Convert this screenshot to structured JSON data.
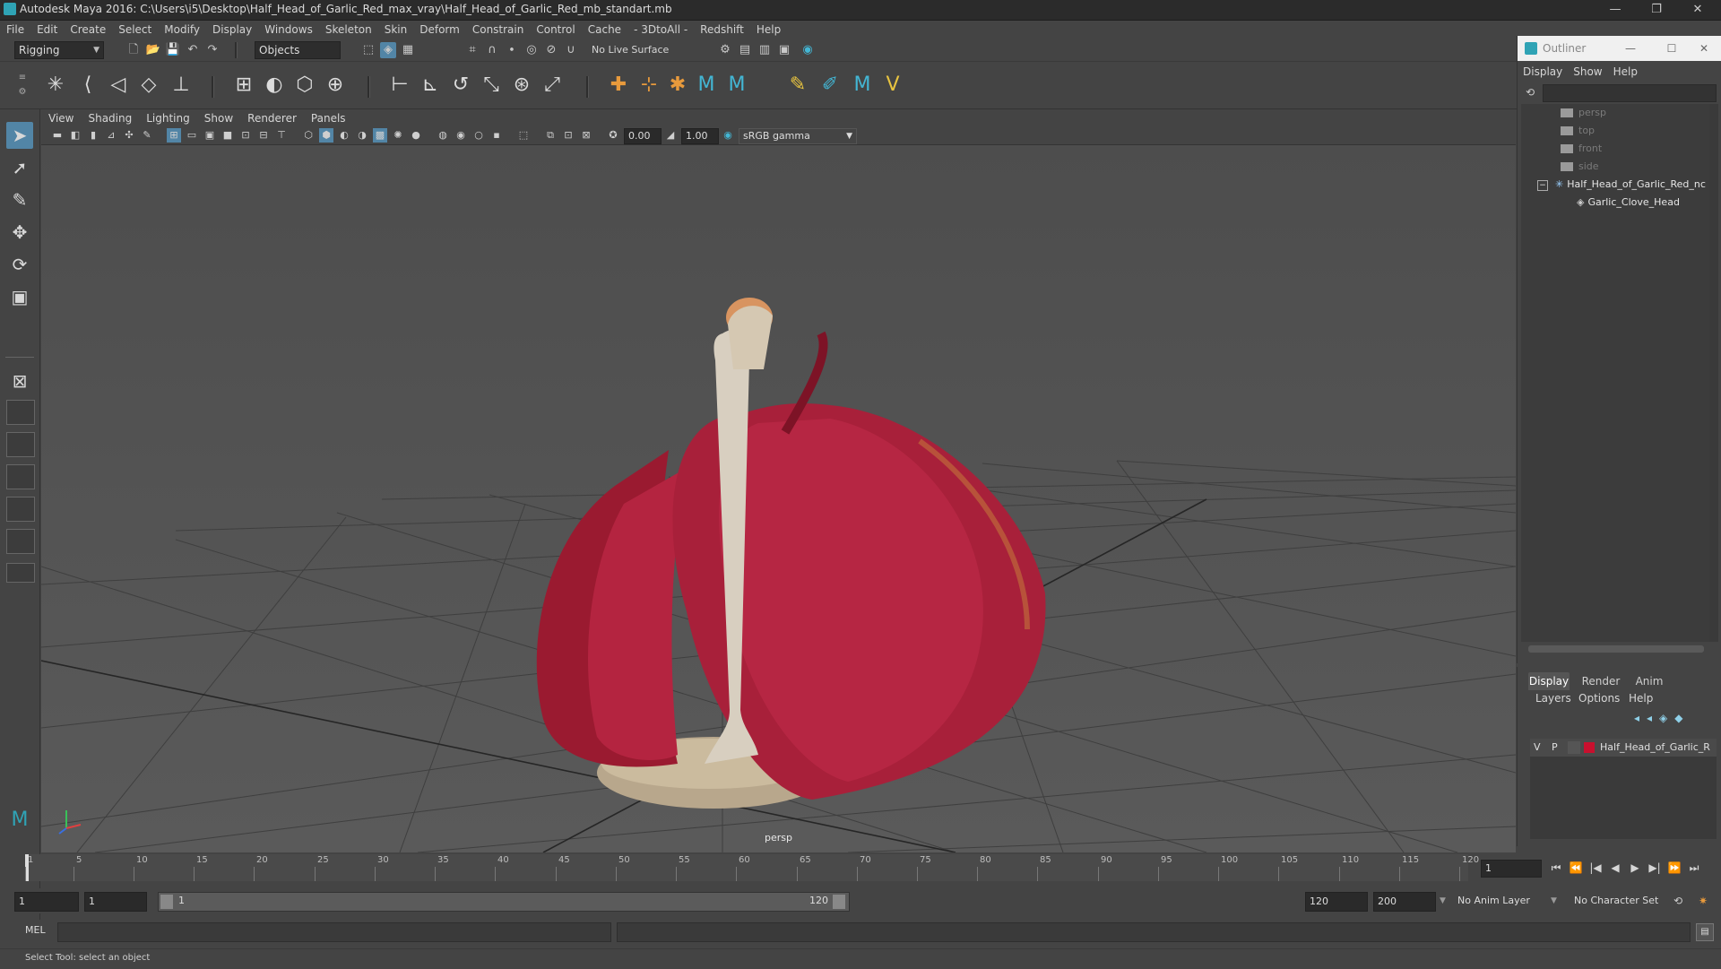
{
  "window": {
    "title": "Autodesk Maya 2016: C:\\Users\\i5\\Desktop\\Half_Head_of_Garlic_Red_max_vray\\Half_Head_of_Garlic_Red_mb_standart.mb",
    "minimize": "—",
    "restore": "❐",
    "close": "✕"
  },
  "menubar": [
    "File",
    "Edit",
    "Create",
    "Select",
    "Modify",
    "Display",
    "Windows",
    "Skeleton",
    "Skin",
    "Deform",
    "Constrain",
    "Control",
    "Cache",
    "- 3DtoAll -",
    "Redshift",
    "Help"
  ],
  "statusline": {
    "mode": "Rigging",
    "selection_mode": "Objects",
    "live_surface": "No Live Surface"
  },
  "viewport": {
    "menu": [
      "View",
      "Shading",
      "Lighting",
      "Show",
      "Renderer",
      "Panels"
    ],
    "exposure": "0.00",
    "gamma": "1.00",
    "color_space": "sRGB gamma",
    "camera_label": "persp"
  },
  "timeslider": {
    "ticks": [
      "1",
      "5",
      "10",
      "15",
      "20",
      "25",
      "30",
      "35",
      "40",
      "45",
      "50",
      "55",
      "60",
      "65",
      "70",
      "75",
      "80",
      "85",
      "90",
      "95",
      "100",
      "105",
      "110",
      "115",
      "120"
    ],
    "current_frame": "1",
    "playback_icons": [
      "⏮",
      "⏪",
      "|◀",
      "◀",
      "▶",
      "▶|",
      "⏩",
      "⏭"
    ]
  },
  "rangeslider": {
    "start": "1",
    "playback_start": "1",
    "range_start_label": "1",
    "range_end_label": "120",
    "playback_end": "120",
    "end": "200",
    "anim_layer": "No Anim Layer",
    "character_set": "No Character Set"
  },
  "commandline": {
    "label": "MEL"
  },
  "helpline": {
    "text": "Select Tool: select an object"
  },
  "outliner": {
    "title": "Outliner",
    "menu": [
      "Display",
      "Show",
      "Help"
    ],
    "items": [
      {
        "label": "persp",
        "type": "camera"
      },
      {
        "label": "top",
        "type": "camera"
      },
      {
        "label": "front",
        "type": "camera"
      },
      {
        "label": "side",
        "type": "camera"
      },
      {
        "label": "Half_Head_of_Garlic_Red_nc",
        "type": "group"
      },
      {
        "label": "Garlic_Clove_Head",
        "type": "mesh"
      }
    ]
  },
  "layereditor": {
    "tabs": [
      "Display",
      "Render",
      "Anim"
    ],
    "menu": [
      "Layers",
      "Options",
      "Help"
    ],
    "layer": {
      "v": "V",
      "p": "P",
      "name": "Half_Head_of_Garlic_R",
      "color": "#c8102e"
    }
  },
  "colors": {
    "accent": "#5285a6",
    "garlic_skin": "#a01c34",
    "stem": "#d8cfc0"
  }
}
